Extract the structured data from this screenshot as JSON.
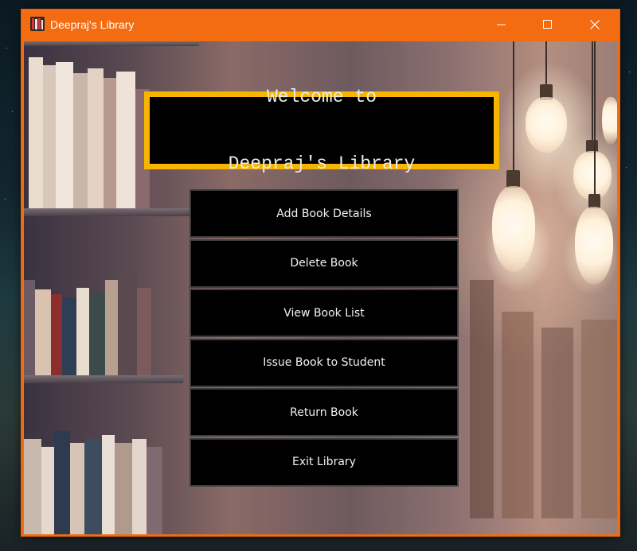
{
  "window": {
    "title": "Deepraj's Library",
    "titlebar_color": "#f36c12",
    "icon": "library-app-icon",
    "controls": [
      "minimize-icon",
      "maximize-icon",
      "close-icon"
    ]
  },
  "welcome": {
    "line1": "Welcome to",
    "line2": "Deepraj's Library",
    "border_color": "#f7b500"
  },
  "menu": {
    "items": [
      {
        "label": "Add Book Details"
      },
      {
        "label": "Delete Book"
      },
      {
        "label": "View Book List"
      },
      {
        "label": "Issue Book to Student"
      },
      {
        "label": "Return Book"
      },
      {
        "label": "Exit Library"
      }
    ]
  },
  "background": {
    "description_icon": "library-bookshelf-background"
  }
}
